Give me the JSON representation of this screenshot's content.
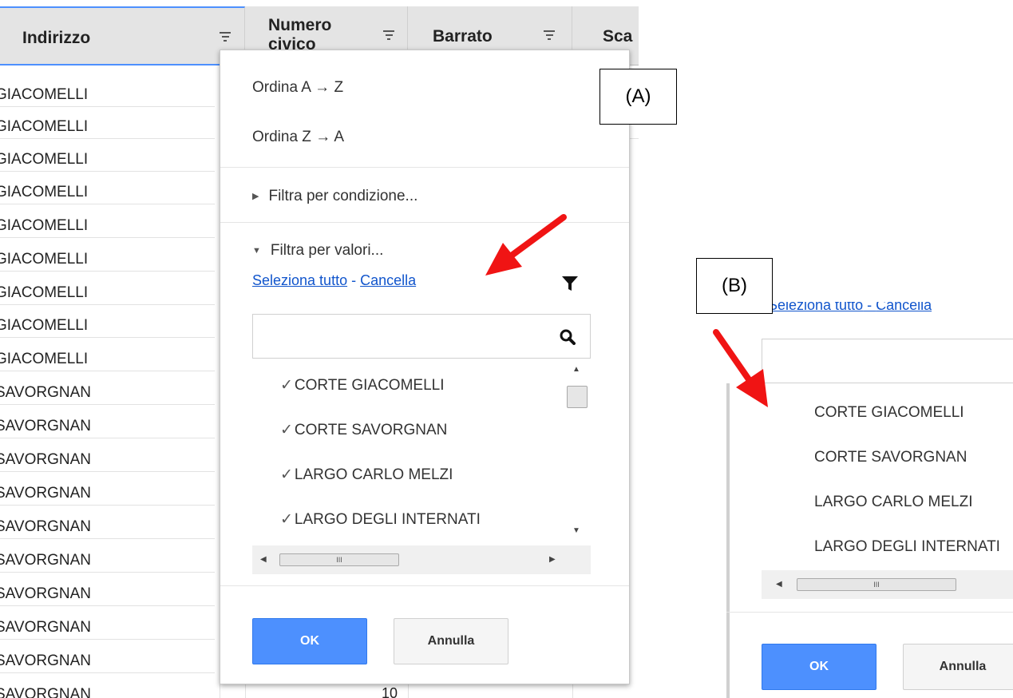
{
  "sheet": {
    "headers": {
      "indirizzo": "Indirizzo",
      "numero_line1": "Numero",
      "numero_line2": "civico",
      "barrato": "Barrato",
      "sca": "Sca"
    },
    "rows": [
      "GIACOMELLI",
      "GIACOMELLI",
      "GIACOMELLI",
      "GIACOMELLI",
      "GIACOMELLI",
      "GIACOMELLI",
      "GIACOMELLI",
      "GIACOMELLI",
      "GIACOMELLI",
      "SAVORGNAN",
      "SAVORGNAN",
      "SAVORGNAN",
      "SAVORGNAN",
      "SAVORGNAN",
      "SAVORGNAN",
      "SAVORGNAN",
      "SAVORGNAN",
      "SAVORGNAN",
      "SAVORGNAN"
    ],
    "last_row_number": "10"
  },
  "popup": {
    "sort_az": "Ordina A → Z",
    "sort_za": "Ordina Z → A",
    "filter_condition": "Filtra per condizione...",
    "filter_values": "Filtra per valori...",
    "select_all": "Seleziona tutto",
    "dash": " - ",
    "clear": "Cancella",
    "values": [
      {
        "label": "CORTE GIACOMELLI",
        "checked": true
      },
      {
        "label": "CORTE SAVORGNAN",
        "checked": true
      },
      {
        "label": "LARGO CARLO MELZI",
        "checked": true
      },
      {
        "label": "LARGO DEGLI INTERNATI",
        "checked": true
      }
    ],
    "ok": "OK",
    "cancel": "Annulla"
  },
  "zoom": {
    "values": [
      "CORTE GIACOMELLI",
      "CORTE SAVORGNAN",
      "LARGO CARLO MELZI",
      "LARGO DEGLI INTERNATI"
    ],
    "ok": "OK",
    "cancel": "Annulla"
  },
  "callouts": {
    "a": "(A)",
    "b": "(B)"
  },
  "colors": {
    "arrow": "#f01414",
    "ok_button": "#4d90fe",
    "link": "#1155cc"
  }
}
